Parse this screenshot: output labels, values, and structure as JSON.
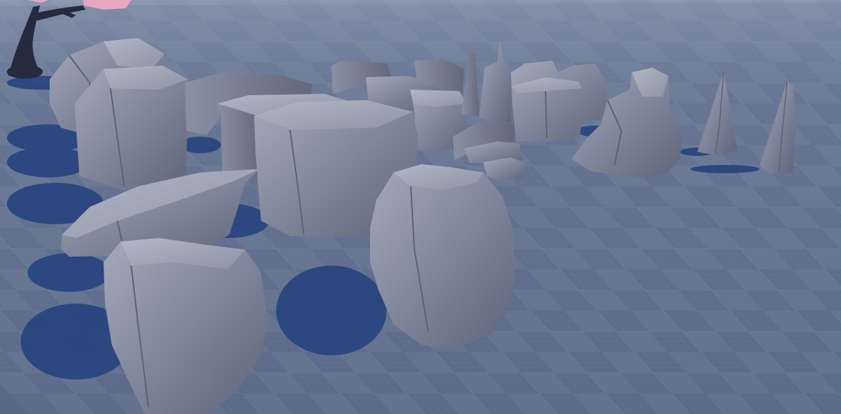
{
  "scene": {
    "kind": "3d-viewport",
    "ground": {
      "pattern": "checker-grid",
      "base_color": "#5d6d89",
      "tile_light": "#6c7c97",
      "tile_dark": "#566681",
      "grid_line": "#7f8ea8"
    },
    "sky_color": "#c9d3e2",
    "shadow_color": "#23407e",
    "rock_colors": {
      "light": "#9aa0b2",
      "mid": "#7b8194",
      "dark": "#5c6275",
      "edge": "#4a5063"
    },
    "tree": {
      "trunk_color": "#252b3d",
      "blossom_color": "#e9a8c2"
    },
    "objects": [
      "cherry-tree",
      "rock-cluster-back-left",
      "rock-tall-left",
      "rock-flat-slab",
      "rock-boulder-front-left",
      "rock-block-large-center",
      "rock-block-back-row",
      "rock-steps",
      "rock-spire-pair",
      "rock-block-right",
      "rock-pile-right",
      "rock-spire-far-right-1",
      "rock-spire-far-right-2",
      "rock-boulder-center"
    ]
  }
}
